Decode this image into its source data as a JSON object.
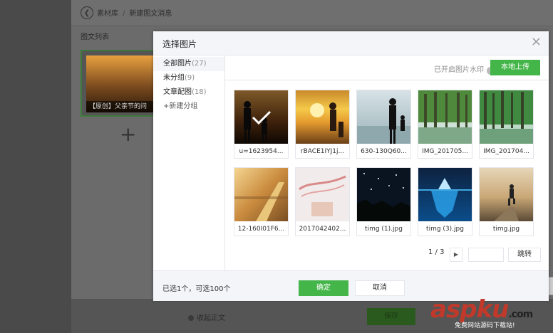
{
  "background": {
    "breadcrumb": [
      "素材库",
      "新建图文消息"
    ],
    "list_title": "图文列表",
    "card_caption": "【原创】父亲节的问",
    "collapse_label": "收起正文",
    "save_label": "保存"
  },
  "watermark": {
    "brand": "aspku",
    "tld": ".com",
    "slogan": "免费网站源码下载站!"
  },
  "modal": {
    "title": "选择图片",
    "close": "×",
    "groups": [
      {
        "label": "全部图片",
        "count": "(27)"
      },
      {
        "label": "未分组",
        "count": "(9)"
      },
      {
        "label": "文章配图",
        "count": "(18)"
      },
      {
        "label": "+新建分组",
        "count": ""
      }
    ],
    "watermark_label": "已开启图片水印",
    "upload_label": "本地上传",
    "images": [
      {
        "name": "u=1623954...",
        "selected": true
      },
      {
        "name": "rBACE1IYJ1j...",
        "selected": false
      },
      {
        "name": "630-130Q60...",
        "selected": false
      },
      {
        "name": "IMG_201705...",
        "selected": false
      },
      {
        "name": "IMG_201704...",
        "selected": false
      },
      {
        "name": "12-160I01F6...",
        "selected": false
      },
      {
        "name": "2017042402...",
        "selected": false
      },
      {
        "name": "timg (1).jpg",
        "selected": false
      },
      {
        "name": "timg (3).jpg",
        "selected": false
      },
      {
        "name": "timg.jpg",
        "selected": false
      }
    ],
    "pager_text": "1 / 3",
    "jump_label": "跳转",
    "selection_info": "已选1个，可选100个",
    "confirm_label": "确定",
    "cancel_label": "取消"
  }
}
